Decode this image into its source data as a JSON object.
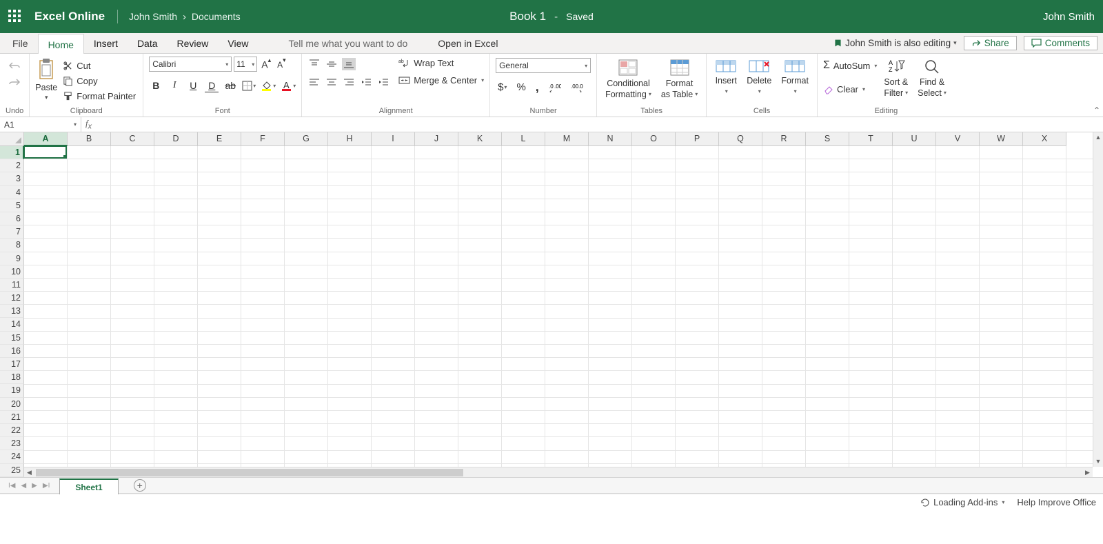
{
  "titlebar": {
    "app_name": "Excel Online",
    "user_name": "John Smith",
    "folder": "Documents",
    "sep": "›",
    "doc_title": "Book 1",
    "saved_sep": "-",
    "saved": "Saved",
    "user_right": "John Smith"
  },
  "tabs": {
    "file": "File",
    "home": "Home",
    "insert": "Insert",
    "data": "Data",
    "review": "Review",
    "view": "View",
    "tell_me": "Tell me what you want to do",
    "open_excel": "Open in Excel",
    "co_edit": "John Smith is also editing",
    "share": "Share",
    "comments": "Comments"
  },
  "ribbon": {
    "undo_label": "Undo",
    "clipboard": {
      "paste": "Paste",
      "cut": "Cut",
      "copy": "Copy",
      "format_painter": "Format Painter",
      "label": "Clipboard"
    },
    "font": {
      "name": "Calibri",
      "size": "11",
      "label": "Font"
    },
    "alignment": {
      "wrap": "Wrap Text",
      "merge": "Merge & Center",
      "label": "Alignment"
    },
    "number": {
      "format": "General",
      "label": "Number"
    },
    "tables": {
      "cond": "Conditional",
      "cond2": "Formatting",
      "fmt_tbl": "Format",
      "fmt_tbl2": "as Table",
      "label": "Tables"
    },
    "cells": {
      "insert": "Insert",
      "delete": "Delete",
      "format": "Format",
      "label": "Cells"
    },
    "editing": {
      "autosum": "AutoSum",
      "clear": "Clear",
      "sort_l1": "Sort &",
      "sort_l2": "Filter",
      "find_l1": "Find &",
      "find_l2": "Select",
      "label": "Editing"
    }
  },
  "formula": {
    "name_box": "A1"
  },
  "columns": [
    "A",
    "B",
    "C",
    "D",
    "E",
    "F",
    "G",
    "H",
    "I",
    "J",
    "K",
    "L",
    "M",
    "N",
    "O",
    "P",
    "Q",
    "R",
    "S",
    "T",
    "U",
    "V",
    "W",
    "X"
  ],
  "rows": [
    "1",
    "2",
    "3",
    "4",
    "5",
    "6",
    "7",
    "8",
    "9",
    "10",
    "11",
    "12",
    "13",
    "14",
    "15",
    "16",
    "17",
    "18",
    "19",
    "20",
    "21",
    "22",
    "23",
    "24",
    "25"
  ],
  "sheet": {
    "name": "Sheet1"
  },
  "status": {
    "loading": "Loading Add-ins",
    "help": "Help Improve Office"
  }
}
